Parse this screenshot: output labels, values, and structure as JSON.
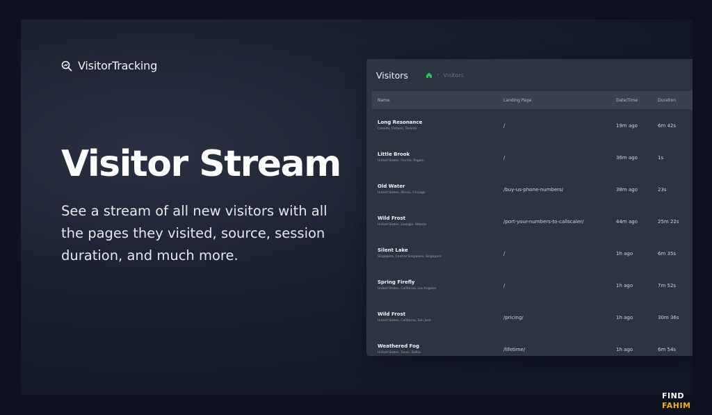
{
  "brand": {
    "name": "VisitorTracking"
  },
  "hero": {
    "headline": "Visitor Stream",
    "description": "See a stream of all new visitors with all the pages they visited, source, session duration, and much more."
  },
  "panel": {
    "title": "Visitors",
    "breadcrumb": {
      "current": "Visitors"
    },
    "columns": [
      "Name",
      "Landing Page",
      "Date/Time",
      "Duration"
    ],
    "rows": [
      {
        "name": "Long Resonance",
        "location": "Canada, Ontario, Toronto",
        "landing": "/",
        "time": "19m ago",
        "duration": "6m 42s"
      },
      {
        "name": "Little Brook",
        "location": "United States, Florida, Pagam",
        "landing": "/",
        "time": "36m ago",
        "duration": "1s"
      },
      {
        "name": "Old Water",
        "location": "United States, Illinois, Chicago",
        "landing": "/buy-us-phone-numbers/",
        "time": "38m ago",
        "duration": "23s"
      },
      {
        "name": "Wild Frost",
        "location": "United States, Georgia, Atlanta",
        "landing": "/port-your-numbers-to-callscaler/",
        "time": "44m ago",
        "duration": "25m 22s"
      },
      {
        "name": "Silent Lake",
        "location": "Singapore, Central Singapore, Singapore",
        "landing": "/",
        "time": "1h ago",
        "duration": "6m 35s"
      },
      {
        "name": "Spring Firefly",
        "location": "United States, California, Los Angeles",
        "landing": "/",
        "time": "1h ago",
        "duration": "7m 52s"
      },
      {
        "name": "Wild Frost",
        "location": "United States, California, San Jose",
        "landing": "/pricing/",
        "time": "1h ago",
        "duration": "30m 36s"
      },
      {
        "name": "Weathered Fog",
        "location": "United States, Texas, Dallas",
        "landing": "/lifetime/",
        "time": "1h ago",
        "duration": "6m 54s"
      }
    ]
  },
  "watermark": {
    "line1": "FIND",
    "line2": "FAHIM"
  },
  "colors": {
    "background": "#0d1120",
    "panel": "#2c3441",
    "header_row": "#39414d",
    "accent": "#22c55e"
  },
  "icons": {
    "brand": "search-chart-icon",
    "breadcrumb_home": "home-icon",
    "breadcrumb_separator": "chevron-right-icon"
  }
}
